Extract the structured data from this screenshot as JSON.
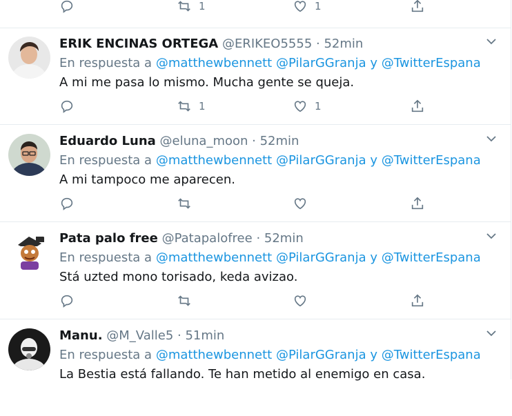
{
  "previous_tweet": {
    "retweets": "1",
    "likes": "1"
  },
  "reply_prefix": "En respuesta a",
  "reply_and": "y",
  "mentions": [
    "@matthewbennett",
    "@PilarGGranja",
    "@TwitterEspana"
  ],
  "tweets": [
    {
      "name": "ERIK ENCINAS ORTEGA",
      "handle": "@ERIKEO5555",
      "time": "· 52min",
      "text": "A mi me pasa lo mismo. Mucha gente se queja.",
      "retweets": "1",
      "likes": "1"
    },
    {
      "name": "Eduardo Luna",
      "handle": "@eluna_moon",
      "time": "· 52min",
      "text": "A mi tampoco me aparecen.",
      "retweets": "",
      "likes": ""
    },
    {
      "name": "Pata palo free",
      "handle": "@Patapalofree",
      "time": "· 52min",
      "text": "Stá uzted mono torisado, keda avizao.",
      "retweets": "",
      "likes": ""
    },
    {
      "name": "Manu.",
      "handle": "@M_Valle5",
      "time": "· 51min",
      "text": "La Bestia está fallando. Te han metido al enemigo en casa.",
      "retweets": "",
      "likes": ""
    }
  ],
  "colors": {
    "link": "#1b95e0",
    "secondary": "#657786",
    "border": "#e6ecf0",
    "icon": "#657786"
  }
}
